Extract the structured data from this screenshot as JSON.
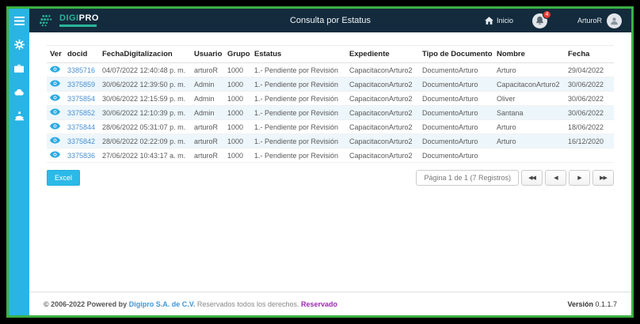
{
  "header": {
    "title": "Consulta por Estatus",
    "logo_digi": "DIGI",
    "logo_pro": "PRO",
    "inicio_label": "Inicio",
    "notification_count": "4",
    "username": "ArturoR"
  },
  "table": {
    "columns": [
      "Ver",
      "docid",
      "FechaDigitalizacion",
      "Usuario",
      "Grupo",
      "Estatus",
      "Expediente",
      "Tipo de Documento",
      "Nombre",
      "Fecha"
    ],
    "rows": [
      {
        "docid": "3385716",
        "fecha_dig": "04/07/2022 12:40:48 p. m.",
        "usuario": "arturoR",
        "grupo": "1000",
        "estatus": "1.- Pendiente por Revisión",
        "expediente": "CapacitaconArturo2",
        "tipo": "DocumentoArturo",
        "nombre": "Arturo",
        "fecha": "29/04/2022"
      },
      {
        "docid": "3375859",
        "fecha_dig": "30/06/2022 12:39:50 p. m.",
        "usuario": "Admin",
        "grupo": "1000",
        "estatus": "1.- Pendiente por Revisión",
        "expediente": "CapacitaconArturo2",
        "tipo": "DocumentoArturo",
        "nombre": "CapacitaconArturo2",
        "fecha": "30/06/2022"
      },
      {
        "docid": "3375854",
        "fecha_dig": "30/06/2022 12:15:59 p. m.",
        "usuario": "Admin",
        "grupo": "1000",
        "estatus": "1.- Pendiente por Revisión",
        "expediente": "CapacitaconArturo2",
        "tipo": "DocumentoArturo",
        "nombre": "Oliver",
        "fecha": "30/06/2022"
      },
      {
        "docid": "3375852",
        "fecha_dig": "30/06/2022 12:10:39 p. m.",
        "usuario": "Admin",
        "grupo": "1000",
        "estatus": "1.- Pendiente por Revisión",
        "expediente": "CapacitaconArturo2",
        "tipo": "DocumentoArturo",
        "nombre": "Santana",
        "fecha": "30/06/2022"
      },
      {
        "docid": "3375844",
        "fecha_dig": "28/06/2022 05:31:07 p. m.",
        "usuario": "arturoR",
        "grupo": "1000",
        "estatus": "1.- Pendiente por Revisión",
        "expediente": "CapacitaconArturo2",
        "tipo": "DocumentoArturo",
        "nombre": "Arturo",
        "fecha": "18/06/2022"
      },
      {
        "docid": "3375842",
        "fecha_dig": "28/06/2022 02:22:09 p. m.",
        "usuario": "arturoR",
        "grupo": "1000",
        "estatus": "1.- Pendiente por Revisión",
        "expediente": "CapacitaconArturo2",
        "tipo": "DocumentoArturo",
        "nombre": "Arturo",
        "fecha": "16/12/2020"
      },
      {
        "docid": "3375836",
        "fecha_dig": "27/06/2022 10:43:17 a. m.",
        "usuario": "arturoR",
        "grupo": "1000",
        "estatus": "1.- Pendiente por Revisión",
        "expediente": "CapacitaconArturo2",
        "tipo": "DocumentoArturo",
        "nombre": "",
        "fecha": ""
      }
    ]
  },
  "actions": {
    "excel_label": "Excel"
  },
  "pagination": {
    "summary": "Página 1 de 1 (7 Registros)",
    "first": "◀◀",
    "prev": "◀",
    "next": "▶",
    "last": "▶▶"
  },
  "footer": {
    "copyright_prefix": "© 2006-2022 Powered by",
    "company_link": "Digipro S.A. de C.V.",
    "rights_text": "Reservados todos los derechos.",
    "reserved_link": "Reservado",
    "version_label": "Versión",
    "version_value": "0.1.1.7"
  },
  "colors": {
    "frame_green": "#3cb043",
    "header_navy": "#132b3d",
    "sidebar_cyan": "#29b4e5",
    "accent_cyan": "#2bbae8",
    "logo_teal": "#2bb59a",
    "badge_red": "#e53935",
    "link_blue": "#4a90d2",
    "reserved_purple": "#9c27b0",
    "row_stripe": "#edf6fb"
  }
}
